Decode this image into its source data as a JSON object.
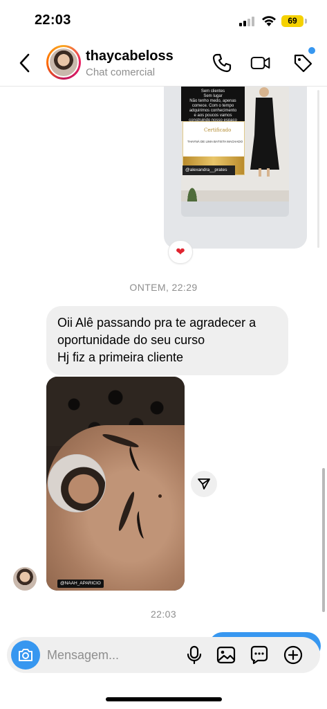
{
  "status_bar": {
    "time": "22:03",
    "battery": "69"
  },
  "header": {
    "contact_name": "thaycabeloss",
    "contact_subtitle": "Chat comercial",
    "icons": [
      "back-icon",
      "phone-icon",
      "video-icon",
      "tag-icon"
    ]
  },
  "shared_post": {
    "text_lines": [
      "Sem clientes",
      "Sem lugar",
      "Não tenho medo, apenas",
      "comece. Com o tempo",
      "adquirimos conhecimento",
      "e aos poucos vamos",
      "construindo nosso espaço"
    ],
    "certificate_title": "Certificado",
    "certificate_name": "THAYNÁ DE LIMA BATISTA MACHADO",
    "handle": "@alexandra__prates",
    "reaction": "❤"
  },
  "messages": {
    "timestamp_1": "ONTEM, 22:29",
    "incoming_lines": [
      "Oii Alê passando pra te agradecer a",
      "oportunidade do seu curso",
      "Hj fiz a primeira cliente"
    ],
    "photo_handle": "@NAAH_APARICIO",
    "timestamp_2": "22:03"
  },
  "composer": {
    "placeholder": "Mensagem...",
    "icons": [
      "camera-icon",
      "microphone-icon",
      "gallery-icon",
      "sticker-icon",
      "plus-icon"
    ]
  },
  "colors": {
    "accent": "#3797f0",
    "bubble": "#efefef",
    "battery": "#f5d100",
    "reaction": "#e0242f"
  }
}
